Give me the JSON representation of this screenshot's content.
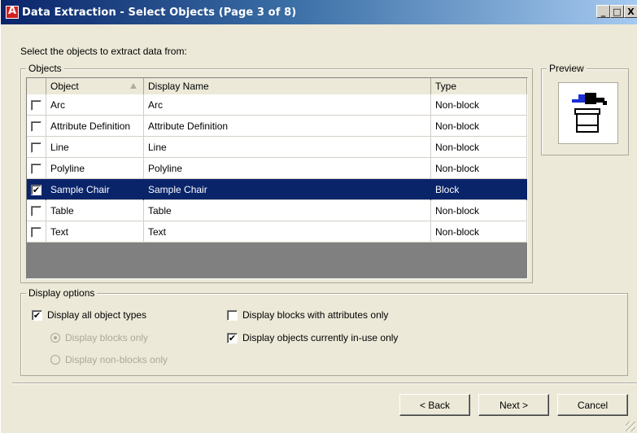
{
  "window": {
    "title": "Data Extraction - Select Objects (Page 3 of 8)",
    "minimize_label": "_",
    "maximize_label": "□",
    "close_label": "X"
  },
  "instruction": "Select the objects to extract data from:",
  "objects": {
    "legend": "Objects",
    "columns": [
      "Object",
      "Display Name",
      "Type"
    ],
    "rows": [
      {
        "checked": false,
        "object": "Arc",
        "display_name": "Arc",
        "type": "Non-block"
      },
      {
        "checked": false,
        "object": "Attribute Definition",
        "display_name": "Attribute Definition",
        "type": "Non-block"
      },
      {
        "checked": false,
        "object": "Line",
        "display_name": "Line",
        "type": "Non-block"
      },
      {
        "checked": false,
        "object": "Polyline",
        "display_name": "Polyline",
        "type": "Non-block"
      },
      {
        "checked": true,
        "object": "Sample Chair",
        "display_name": "Sample Chair",
        "type": "Block",
        "selected": true
      },
      {
        "checked": false,
        "object": "Table",
        "display_name": "Table",
        "type": "Non-block"
      },
      {
        "checked": false,
        "object": "Text",
        "display_name": "Text",
        "type": "Non-block"
      }
    ]
  },
  "preview": {
    "legend": "Preview"
  },
  "display_options": {
    "legend": "Display options",
    "all_types": {
      "label": "Display all object types",
      "checked": true
    },
    "blocks_only": {
      "label": "Display blocks only",
      "selected": true,
      "enabled": false
    },
    "nonblocks_only": {
      "label": "Display non-blocks only",
      "selected": false,
      "enabled": false
    },
    "blocks_with_attr": {
      "label": "Display blocks with attributes only",
      "checked": false
    },
    "in_use_only": {
      "label": "Display objects currently in-use only",
      "checked": true
    }
  },
  "buttons": {
    "back": "< Back",
    "next": "Next >",
    "cancel": "Cancel"
  },
  "colors": {
    "selection": "#0a246a",
    "dialog_bg": "#ece9d8",
    "list_empty": "#808080"
  }
}
